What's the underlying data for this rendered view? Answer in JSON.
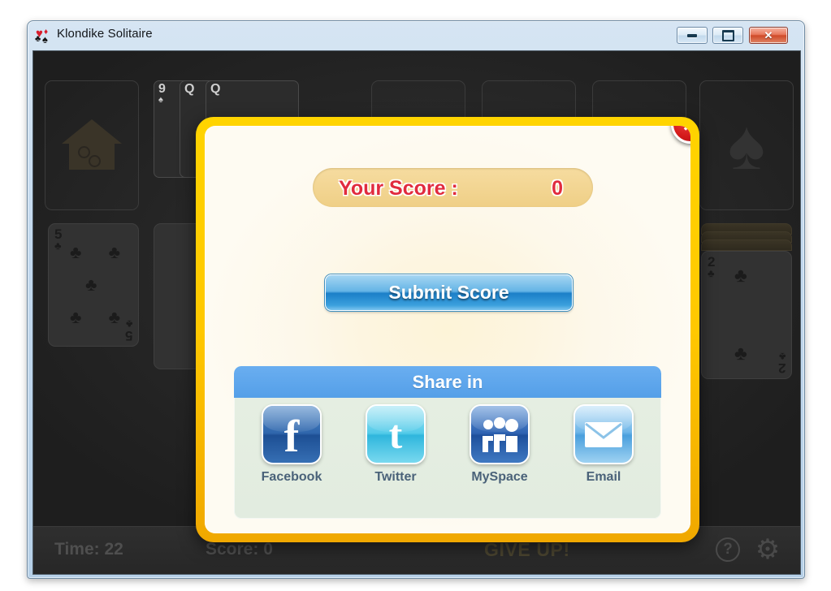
{
  "window": {
    "title": "Klondike Solitaire",
    "icon": "cards-suits-icon",
    "controls": {
      "minimize": "minimize-button",
      "maximize": "maximize-button",
      "close": "close-button",
      "close_glyph": "✕"
    }
  },
  "dialog": {
    "close_glyph": "✕",
    "score": {
      "label": "Your Score :",
      "value": "0"
    },
    "submit_label": "Submit Score",
    "share": {
      "title": "Share in",
      "items": [
        {
          "label": "Facebook",
          "icon": "facebook-icon",
          "glyph": "f"
        },
        {
          "label": "Twitter",
          "icon": "twitter-icon",
          "glyph": "t"
        },
        {
          "label": "MySpace",
          "icon": "myspace-icon",
          "glyph": ""
        },
        {
          "label": "Email",
          "icon": "email-icon",
          "glyph": ""
        }
      ]
    }
  },
  "statusbar": {
    "time": "Time: 22",
    "score": "Score: 0",
    "give_up": "GIVE UP!",
    "help_glyph": "?",
    "gear_glyph": "⚙"
  },
  "board": {
    "stock_icon": "house-icon",
    "waste_cards": [
      {
        "rank": "9",
        "suit": "♠"
      },
      {
        "rank": "Q",
        "suit": ""
      },
      {
        "rank": "Q",
        "suit": ""
      }
    ],
    "tableau_cards": [
      {
        "rank": "5",
        "suit": "♣",
        "name": "five-of-clubs-card"
      },
      {
        "rank": "2",
        "suit": "♣",
        "name": "two-of-clubs-card"
      }
    ],
    "foundation_suit": "♠"
  },
  "colors": {
    "dialog_border": "#ffc800",
    "accent_blue": "#549fe8",
    "score_red": "#e12b3e",
    "felt": "#242424"
  }
}
